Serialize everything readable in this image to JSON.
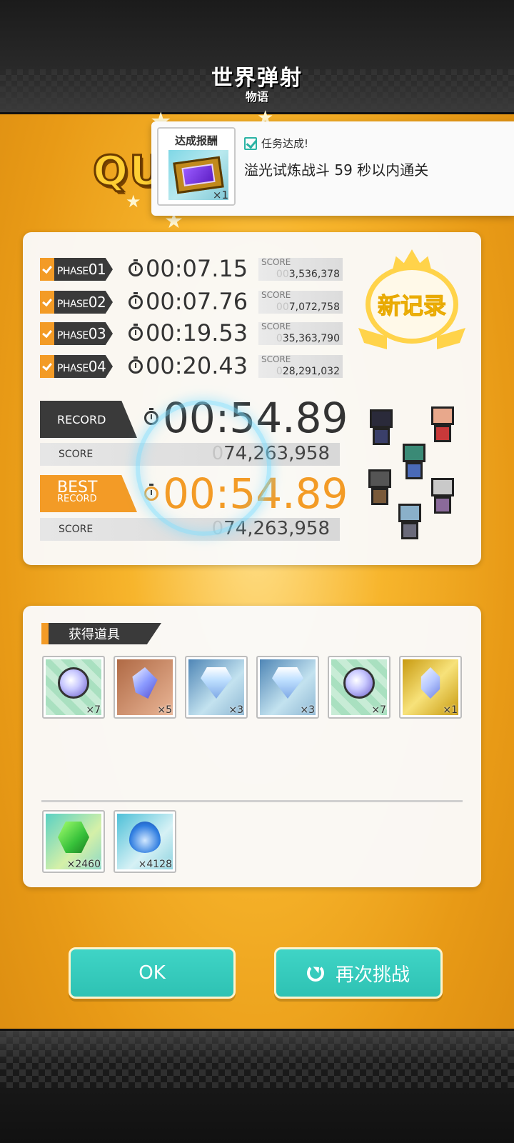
{
  "header": {
    "logo_line1": "世界弹射",
    "logo_line2": "物语"
  },
  "quest_title_partial": "QU",
  "toast": {
    "reward_label": "达成报酬",
    "reward_qty": "×1",
    "status": "任务达成!",
    "mission": "溢光试炼战斗 59 秒以内通关"
  },
  "phases": [
    {
      "prefix": "PHASE",
      "num": "01",
      "time": "00:07.15",
      "score_label": "SCORE",
      "score_dim": "00",
      "score": "3,536,378"
    },
    {
      "prefix": "PHASE",
      "num": "02",
      "time": "00:07.76",
      "score_label": "SCORE",
      "score_dim": "00",
      "score": "7,072,758"
    },
    {
      "prefix": "PHASE",
      "num": "03",
      "time": "00:19.53",
      "score_label": "SCORE",
      "score_dim": "0",
      "score": "35,363,790"
    },
    {
      "prefix": "PHASE",
      "num": "04",
      "time": "00:20.43",
      "score_label": "SCORE",
      "score_dim": "0",
      "score": "28,291,032"
    }
  ],
  "record": {
    "label": "RECORD",
    "time": "00:54.89",
    "score_label": "SCORE",
    "score_dim": "0",
    "score": "74,263,958"
  },
  "best_record": {
    "label_line1": "BEST",
    "label_line2": "RECORD",
    "time": "00:54.89",
    "score_label": "SCORE",
    "score_dim": "0",
    "score": "74,263,958"
  },
  "new_record_badge": "新记录",
  "items": {
    "header": "获得道具",
    "row1": [
      {
        "icon": "crystal-orb-icon",
        "qty": "×7"
      },
      {
        "icon": "mana-crystal-icon",
        "qty": "×5"
      },
      {
        "icon": "diamond-icon",
        "qty": "×3"
      },
      {
        "icon": "diamond-icon",
        "qty": "×3"
      },
      {
        "icon": "crystal-orb-icon",
        "qty": "×7"
      },
      {
        "icon": "winged-gem-icon",
        "qty": "×1"
      }
    ],
    "row2": [
      {
        "icon": "green-gem-icon",
        "qty": "×2460"
      },
      {
        "icon": "blue-flame-icon",
        "qty": "×4128"
      }
    ]
  },
  "buttons": {
    "ok": "OK",
    "retry": "再次挑战"
  },
  "colors": {
    "accent_orange": "#f39b26",
    "accent_teal": "#2ec2b3",
    "dark": "#3a3a3a",
    "badge_gold": "#ffd34a"
  }
}
